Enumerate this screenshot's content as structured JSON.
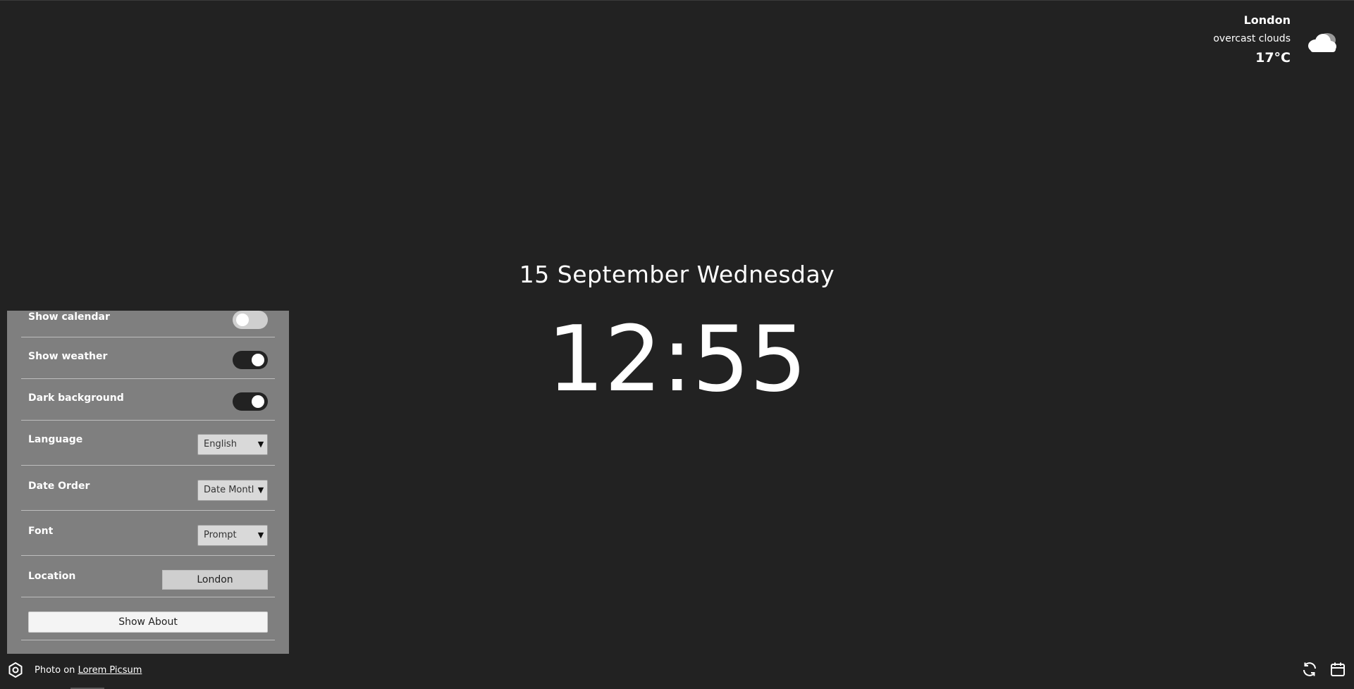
{
  "weather": {
    "city": "London",
    "description": "overcast clouds",
    "temperature": "17°C",
    "icon": "cloud-icon"
  },
  "clock": {
    "date": "15 September Wednesday",
    "time": "12:55"
  },
  "settings": {
    "show_calendar": {
      "label": "Show calendar",
      "enabled": false
    },
    "show_weather": {
      "label": "Show weather",
      "enabled": true
    },
    "dark_background": {
      "label": "Dark background",
      "enabled": true
    },
    "language": {
      "label": "Language",
      "value": "English"
    },
    "date_order": {
      "label": "Date Order",
      "value": "Date Montl"
    },
    "font": {
      "label": "Font",
      "value": "Prompt"
    },
    "location": {
      "label": "Location",
      "value": "London"
    },
    "about_button": "Show About"
  },
  "footer": {
    "photo_prefix": "Photo on",
    "photo_link": "Lorem Picsum",
    "icons": [
      "gear-icon",
      "refresh-icon",
      "calendar-icon"
    ]
  },
  "colors": {
    "background": "#222222",
    "panel": "#7f7f7f",
    "toggle_on": "#222222",
    "toggle_off": "#cfcfcf"
  }
}
